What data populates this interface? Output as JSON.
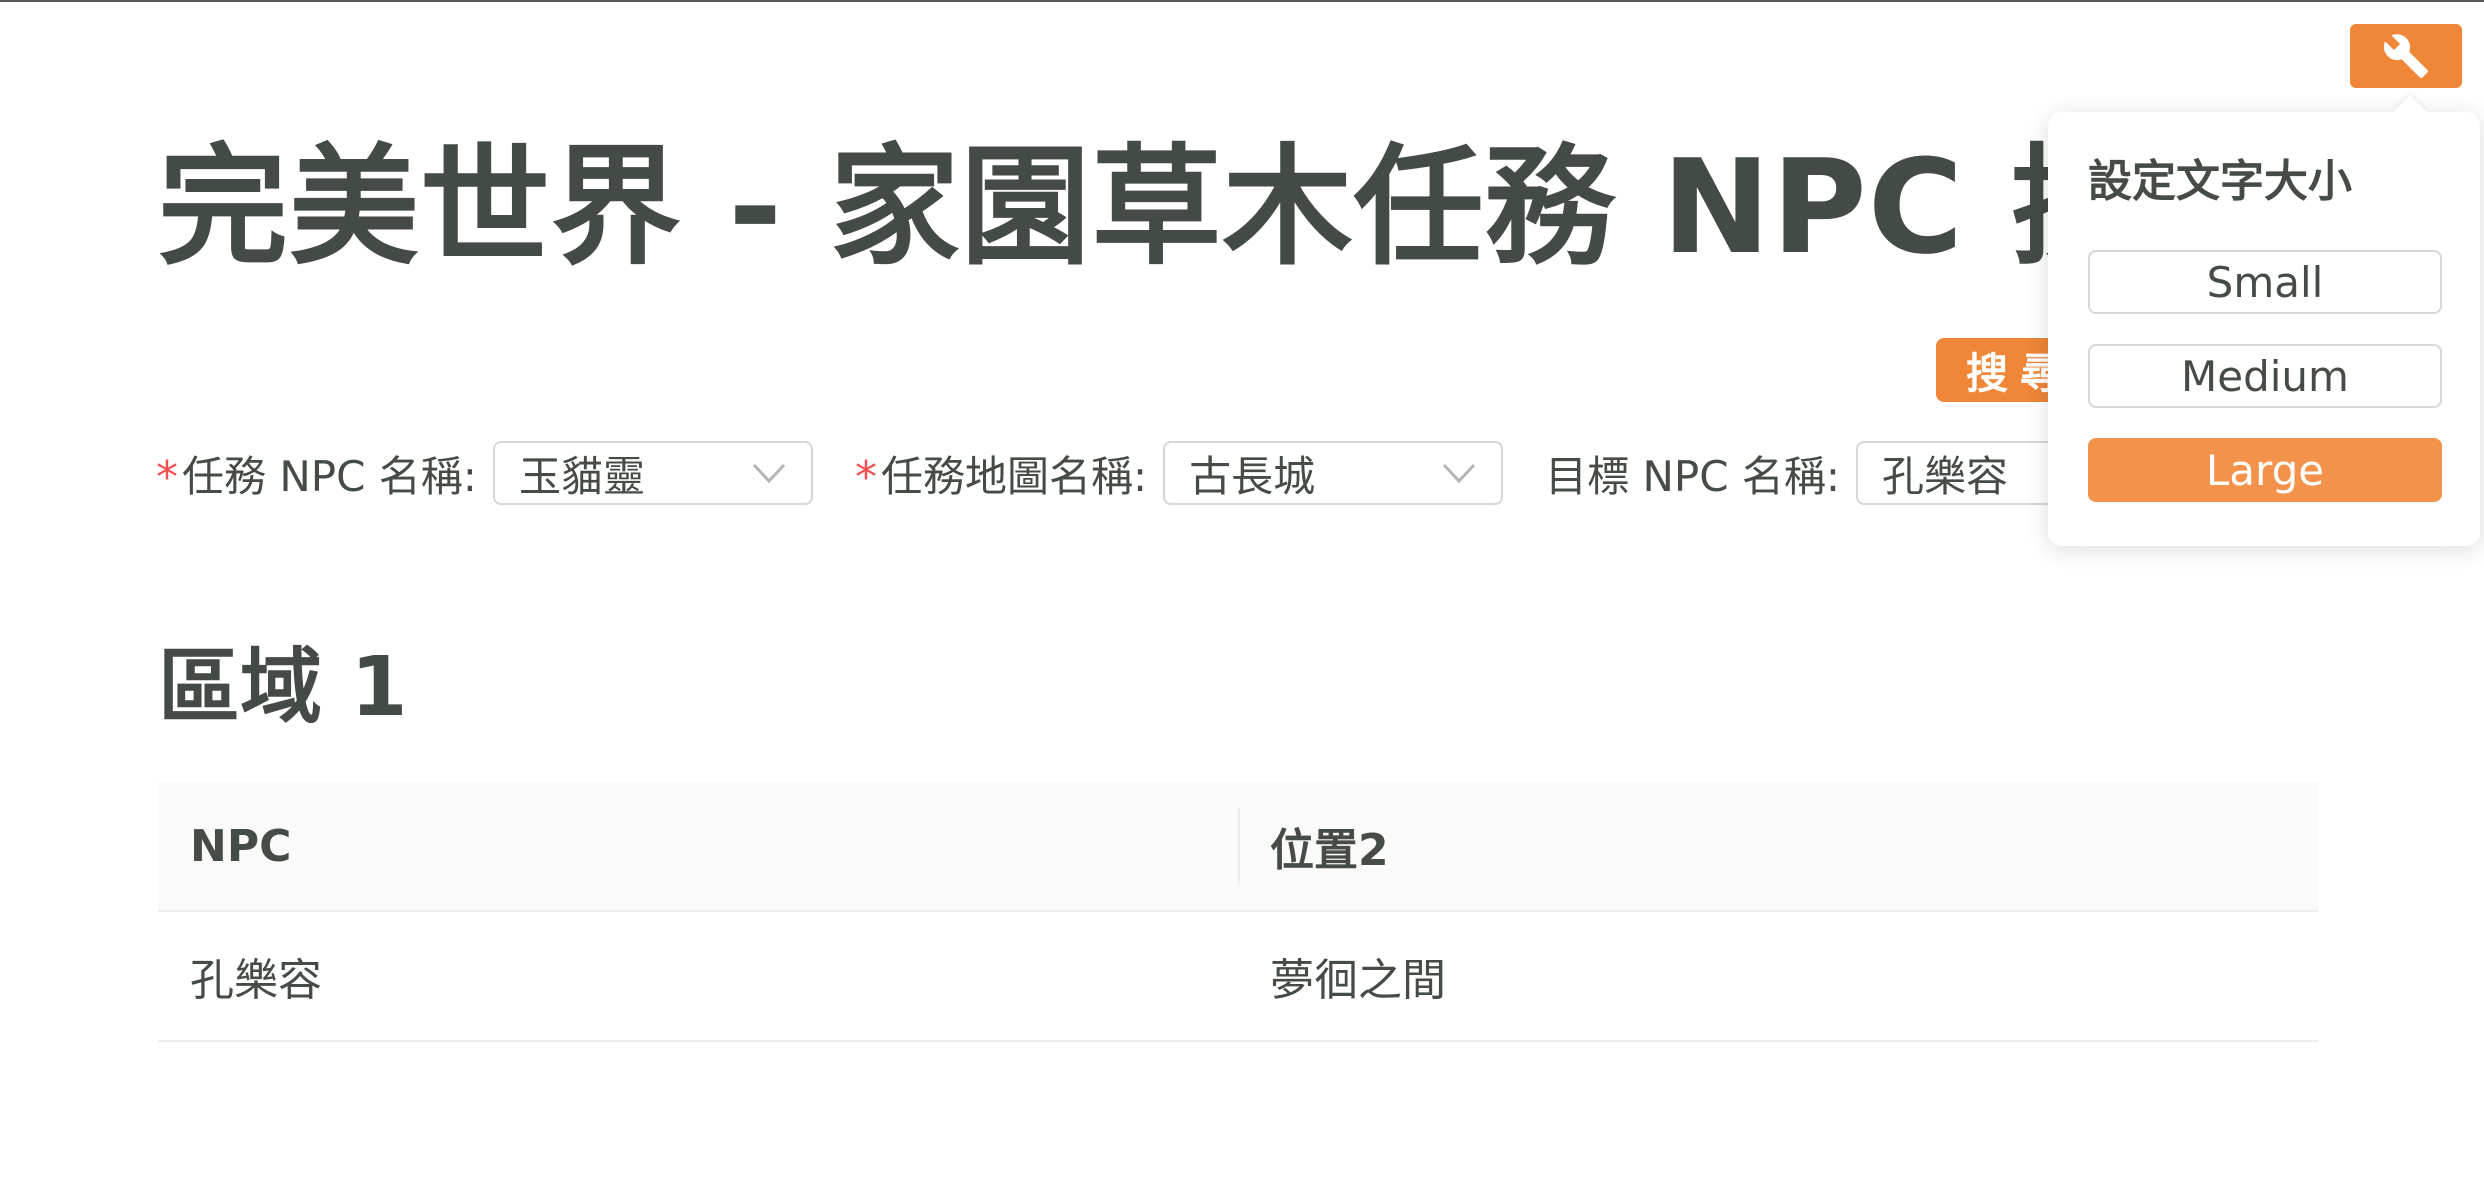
{
  "page": {
    "title": "完美世界 - 家園草木任務 NPC 搜尋"
  },
  "search_button": {
    "label": "搜尋"
  },
  "form": {
    "task_npc": {
      "label": "任務 NPC 名稱:",
      "value": "玉貓靈",
      "required": true
    },
    "task_map": {
      "label": "任務地圖名稱:",
      "value": "古長城",
      "required": true
    },
    "target_npc": {
      "label": "目標 NPC 名稱:",
      "value": "孔樂容",
      "required": false
    },
    "required_mark": "*"
  },
  "section": {
    "title": "區域 1"
  },
  "table": {
    "headers": [
      "NPC",
      "位置2"
    ],
    "rows": [
      [
        "孔樂容",
        "夢徊之間"
      ]
    ]
  },
  "settings": {
    "icon": "wrench-icon",
    "popover_title": "設定文字大小",
    "options": [
      "Small",
      "Medium",
      "Large"
    ],
    "selected": "Large"
  },
  "colors": {
    "accent": "#ef8638",
    "accent_light": "#f2924b",
    "required": "#f05050",
    "text": "#454c46"
  }
}
